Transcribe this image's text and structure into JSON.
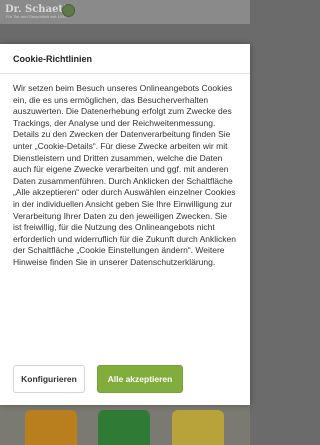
{
  "site": {
    "logo_text": "Dr. Schaette",
    "logo_sub": "Für Tier und Gesundheit seit 1930"
  },
  "cookie_modal": {
    "title": "Cookie-Richtlinien",
    "body": "Wir setzen beim Besuch unseres Onlineangebots Cookies ein, die es uns ermöglichen, das Besucherverhalten auszuwerten. Die Datenerhebung erfolgt zum Zwecke des Trackings, der Analyse und der Reichweitenmessung. Details zu den Zwecken der Datenverarbeitung finden Sie unter „Cookie-Details“. Für diese Zwecke arbeiten wir mit Dienstleistern und Dritten zusammen, welche die Daten auch für eigene Zwecke verarbeiten und ggf. mit anderen Daten zusammenführen. Durch Anklicken der Schaltfläche „Alle akzeptieren“ oder durch Auswählen einzelner Cookies in der individuellen Ansicht geben Sie Ihre Einwilligung zur Verarbeitung Ihrer Daten zu den jeweiligen Zwecken. Sie ist freiwillig, für die Nutzung des Onlineangebots nicht erforderlich und widerruflich für die Zukunft durch Anklicken der Schaltfläche „Cookie Einstellungen ändern“. Weitere Hinweise finden Sie in unserer Datenschutzerklärung.",
    "configure_label": "Konfigurieren",
    "accept_all_label": "Alle akzeptieren"
  },
  "colors": {
    "accept_button": "#81ad3c",
    "overlay": "#6b6b6b"
  }
}
